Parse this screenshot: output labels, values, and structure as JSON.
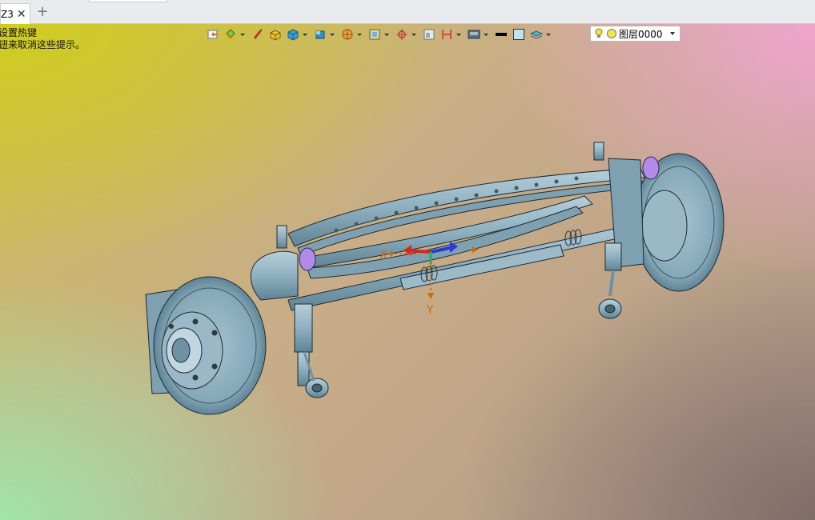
{
  "tabbar": {
    "active_tab_label": "Z3",
    "close_glyph": "✕",
    "add_glyph": "+"
  },
  "viewport": {
    "hint_line1": "设置热键",
    "hint_line2": "钮来取消这些提示。",
    "background_colors": {
      "top_left": "#d0cc1e",
      "top_right": "#f2a5d2",
      "bottom_left": "#a0e4aa",
      "bottom_right": "#806c68"
    }
  },
  "toolbar": {
    "buttons": [
      {
        "icon": "import-icon"
      },
      {
        "icon": "paint-bucket-icon",
        "dropdown": true
      },
      {
        "icon": "brush-icon"
      },
      {
        "icon": "solid-box-icon"
      },
      {
        "icon": "cube-icon",
        "dropdown": true
      },
      {
        "icon": "view-cube-icon",
        "dropdown": true
      },
      {
        "icon": "section-icon",
        "dropdown": true
      },
      {
        "icon": "frame-select-icon",
        "dropdown": true
      },
      {
        "icon": "snap-target-icon",
        "dropdown": true
      },
      {
        "icon": "window-icon"
      },
      {
        "icon": "measure-icon",
        "dropdown": true
      },
      {
        "icon": "display-icon",
        "dropdown": true
      },
      {
        "icon": "line-color-icon"
      },
      {
        "icon": "fill-color-icon"
      },
      {
        "icon": "layers-icon",
        "dropdown": true
      }
    ],
    "layer_select_value": "图层0000",
    "layer_color": "#e8e84a"
  },
  "model": {
    "axis_x_label": "X",
    "axis_y_label": "Y",
    "part_color": "#8fb0c0",
    "marker_color": "#b48ae8"
  }
}
